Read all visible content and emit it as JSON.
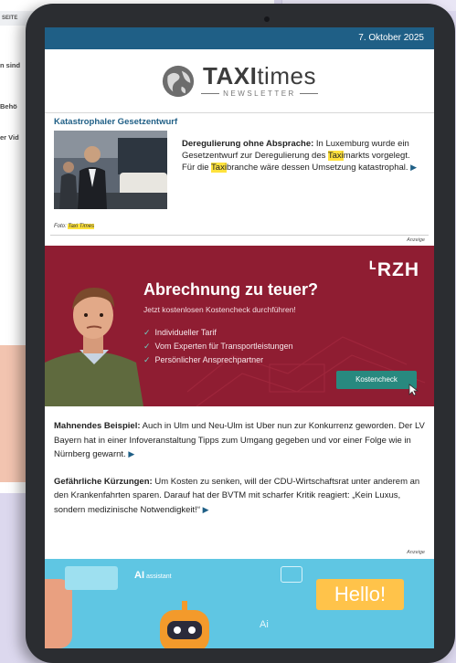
{
  "background": {
    "topbar_label": "SEITE",
    "fragments": [
      "n sind",
      "Behö",
      "er Vid"
    ]
  },
  "newsletter": {
    "date": "7. Oktober 2025",
    "logo": {
      "title_bold": "TAXI",
      "title_light": "times",
      "subtitle": "NEWSLETTER"
    },
    "article1": {
      "title": "Katastrophaler Gesetzentwurf",
      "lead": "Deregulierung ohne Absprache:",
      "text_a": " In Luxemburg wurde ein Gesetzentwurf zur Deregulierung des ",
      "hl1": "Taxi",
      "text_b": "markts vorgelegt. Für die ",
      "hl2": "Taxi",
      "text_c": "branche wäre dessen Umsetzung katastrophal.",
      "caption_prefix": "Foto: ",
      "caption_hl": "Taxi Times"
    },
    "anzeige_label": "Anzeige",
    "ad": {
      "brand": "ᒻRZH",
      "title": "Abrechnung zu teuer?",
      "subtitle": "Jetzt kostenlosen Kostencheck durchführen!",
      "bullets": [
        "Individueller Tarif",
        "Vom Experten für Transportleistungen",
        "Persönlicher Ansprechpartner"
      ],
      "button": "Kostencheck",
      "accent": "#8f1d32"
    },
    "article2": {
      "lead": "Mahnendes Beispiel:",
      "text": " Auch in Ulm und Neu-Ulm ist Uber nun zur Konkurrenz geworden. Der LV Bayern hat in einer Infoveranstaltung Tipps zum Umgang gegeben und vor einer Folge wie in Nürnberg gewarnt."
    },
    "article3": {
      "lead": "Gefährliche Kürzungen:",
      "text": " Um Kosten zu senken, will der CDU-Wirtschaftsrat unter anderem an den Krankenfahrten sparen. Darauf hat der BVTM mit scharfer Kritik reagiert: „Kein Luxus, sondern medizinische Notwendigkeit!“"
    },
    "ad2": {
      "ai_label": "AI",
      "ai_small": " assistant",
      "hello": "Hello!",
      "ai_bottom": "Ai"
    },
    "arrow_glyph": "▶"
  }
}
